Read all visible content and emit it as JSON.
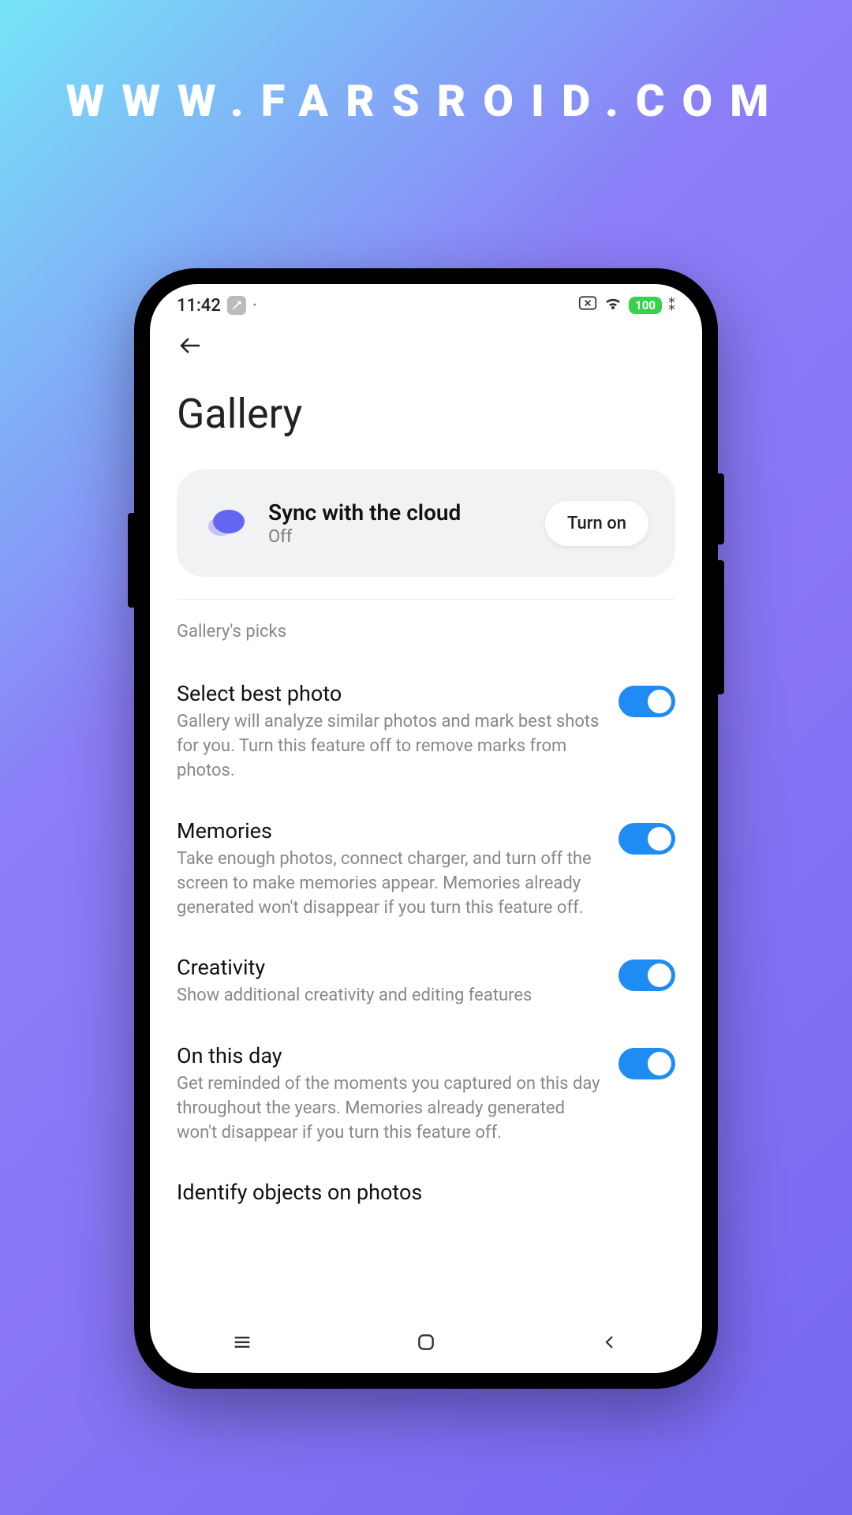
{
  "brand": "WWW.FARSROID.COM",
  "status": {
    "time": "11:42",
    "battery": "100"
  },
  "page": {
    "title": "Gallery"
  },
  "sync": {
    "title": "Sync with the cloud",
    "status": "Off",
    "button": "Turn on"
  },
  "section": {
    "picks_label": "Gallery's picks"
  },
  "settings": [
    {
      "title": "Select best photo",
      "desc": "Gallery will analyze similar photos and mark best shots for you. Turn this feature off to remove marks from photos.",
      "on": true
    },
    {
      "title": "Memories",
      "desc": "Take enough photos, connect charger, and turn off the screen to make memories appear. Memories already generated won't disappear if you turn this feature off.",
      "on": true
    },
    {
      "title": "Creativity",
      "desc": "Show additional creativity and editing features",
      "on": true
    },
    {
      "title": "On this day",
      "desc": "Get reminded of the moments you captured on this day throughout the years. Memories already generated won't disappear if you turn this feature off.",
      "on": true
    },
    {
      "title": "Identify objects on photos",
      "desc": "",
      "on": true
    }
  ]
}
